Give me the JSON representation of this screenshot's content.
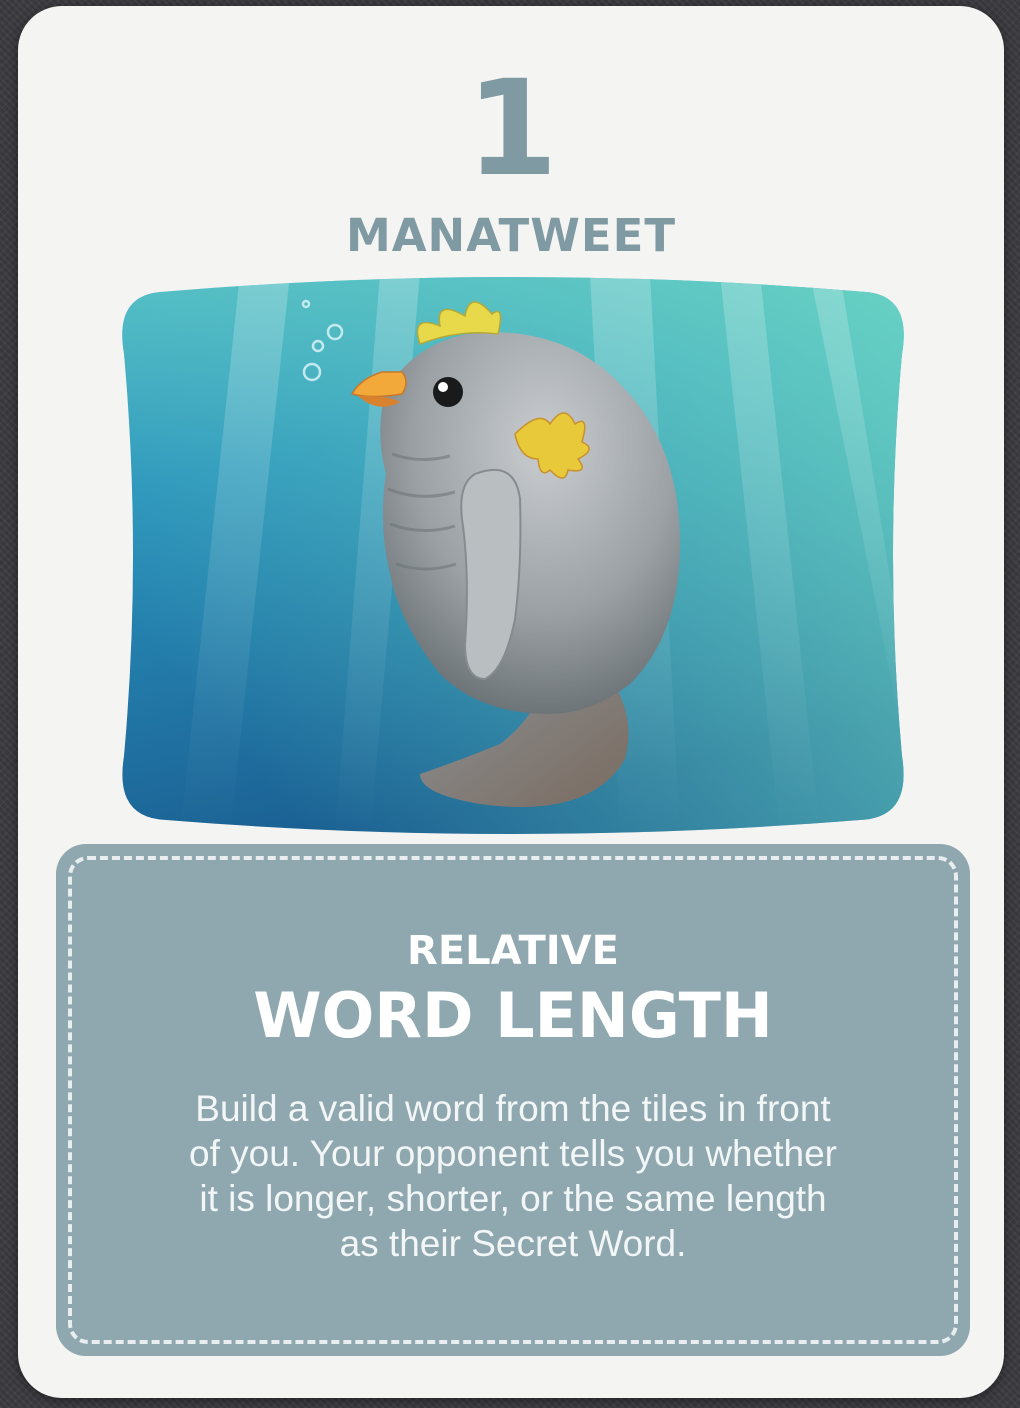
{
  "card": {
    "number": "1",
    "name": "MANATWEET",
    "art": {
      "subject": "manatee-bird-creature",
      "colors": {
        "water_light": "#57c7c0",
        "water_dark": "#1d73a8",
        "body": "#9aa0a4",
        "crest": "#e7d94a",
        "beak": "#f2a93a"
      }
    },
    "rule": {
      "subtitle": "RELATIVE",
      "title": "WORD LENGTH",
      "lines": [
        "Build a valid word from the tiles in front",
        "of you. Your opponent tells you whether",
        "it is longer, shorter, or the same length",
        "as their Secret Word."
      ]
    }
  },
  "colors": {
    "card_bg": "#f4f5f3",
    "accent": "#7f9aa2",
    "rule_bg": "#8fa7ae",
    "rule_text": "#ffffff"
  }
}
